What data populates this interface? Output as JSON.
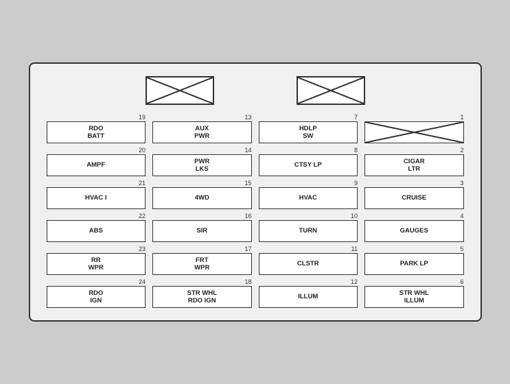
{
  "panel": {
    "top_fuses": [
      {
        "id": "top-left",
        "crossed": true
      },
      {
        "id": "top-right",
        "crossed": true
      }
    ],
    "columns": [
      {
        "id": "col4",
        "fuses": [
          {
            "number": "19",
            "label": "RDO\nBATT",
            "crossed": false
          },
          {
            "number": "20",
            "label": "AMPF",
            "crossed": false
          },
          {
            "number": "21",
            "label": "HVAC I",
            "crossed": false
          },
          {
            "number": "22",
            "label": "ABS",
            "crossed": false
          },
          {
            "number": "23",
            "label": "RR\nWPR",
            "crossed": false
          },
          {
            "number": "24",
            "label": "RDO\nIGN",
            "crossed": false
          }
        ]
      },
      {
        "id": "col3",
        "fuses": [
          {
            "number": "13",
            "label": "AUX\nPWR",
            "crossed": false
          },
          {
            "number": "14",
            "label": "PWR\nLKS",
            "crossed": false
          },
          {
            "number": "15",
            "label": "4WD",
            "crossed": false
          },
          {
            "number": "16",
            "label": "SIR",
            "crossed": false
          },
          {
            "number": "17",
            "label": "FRT\nWPR",
            "crossed": false
          },
          {
            "number": "18",
            "label": "STR WHL\nRDO IGN",
            "crossed": false
          }
        ]
      },
      {
        "id": "col2",
        "fuses": [
          {
            "number": "7",
            "label": "HDLP\nSW",
            "crossed": false
          },
          {
            "number": "8",
            "label": "CTSY LP",
            "crossed": false
          },
          {
            "number": "9",
            "label": "HVAC",
            "crossed": false
          },
          {
            "number": "10",
            "label": "TURN",
            "crossed": false
          },
          {
            "number": "11",
            "label": "CLSTR",
            "crossed": false
          },
          {
            "number": "12",
            "label": "ILLUM",
            "crossed": false
          }
        ]
      },
      {
        "id": "col1",
        "fuses": [
          {
            "number": "1",
            "label": "",
            "crossed": true
          },
          {
            "number": "2",
            "label": "CIGAR\nLTR",
            "crossed": false
          },
          {
            "number": "3",
            "label": "CRUISE",
            "crossed": false
          },
          {
            "number": "4",
            "label": "GAUGES",
            "crossed": false
          },
          {
            "number": "5",
            "label": "PARK LP",
            "crossed": false
          },
          {
            "number": "6",
            "label": "STR WHL\nILLUM",
            "crossed": false
          }
        ]
      }
    ]
  }
}
